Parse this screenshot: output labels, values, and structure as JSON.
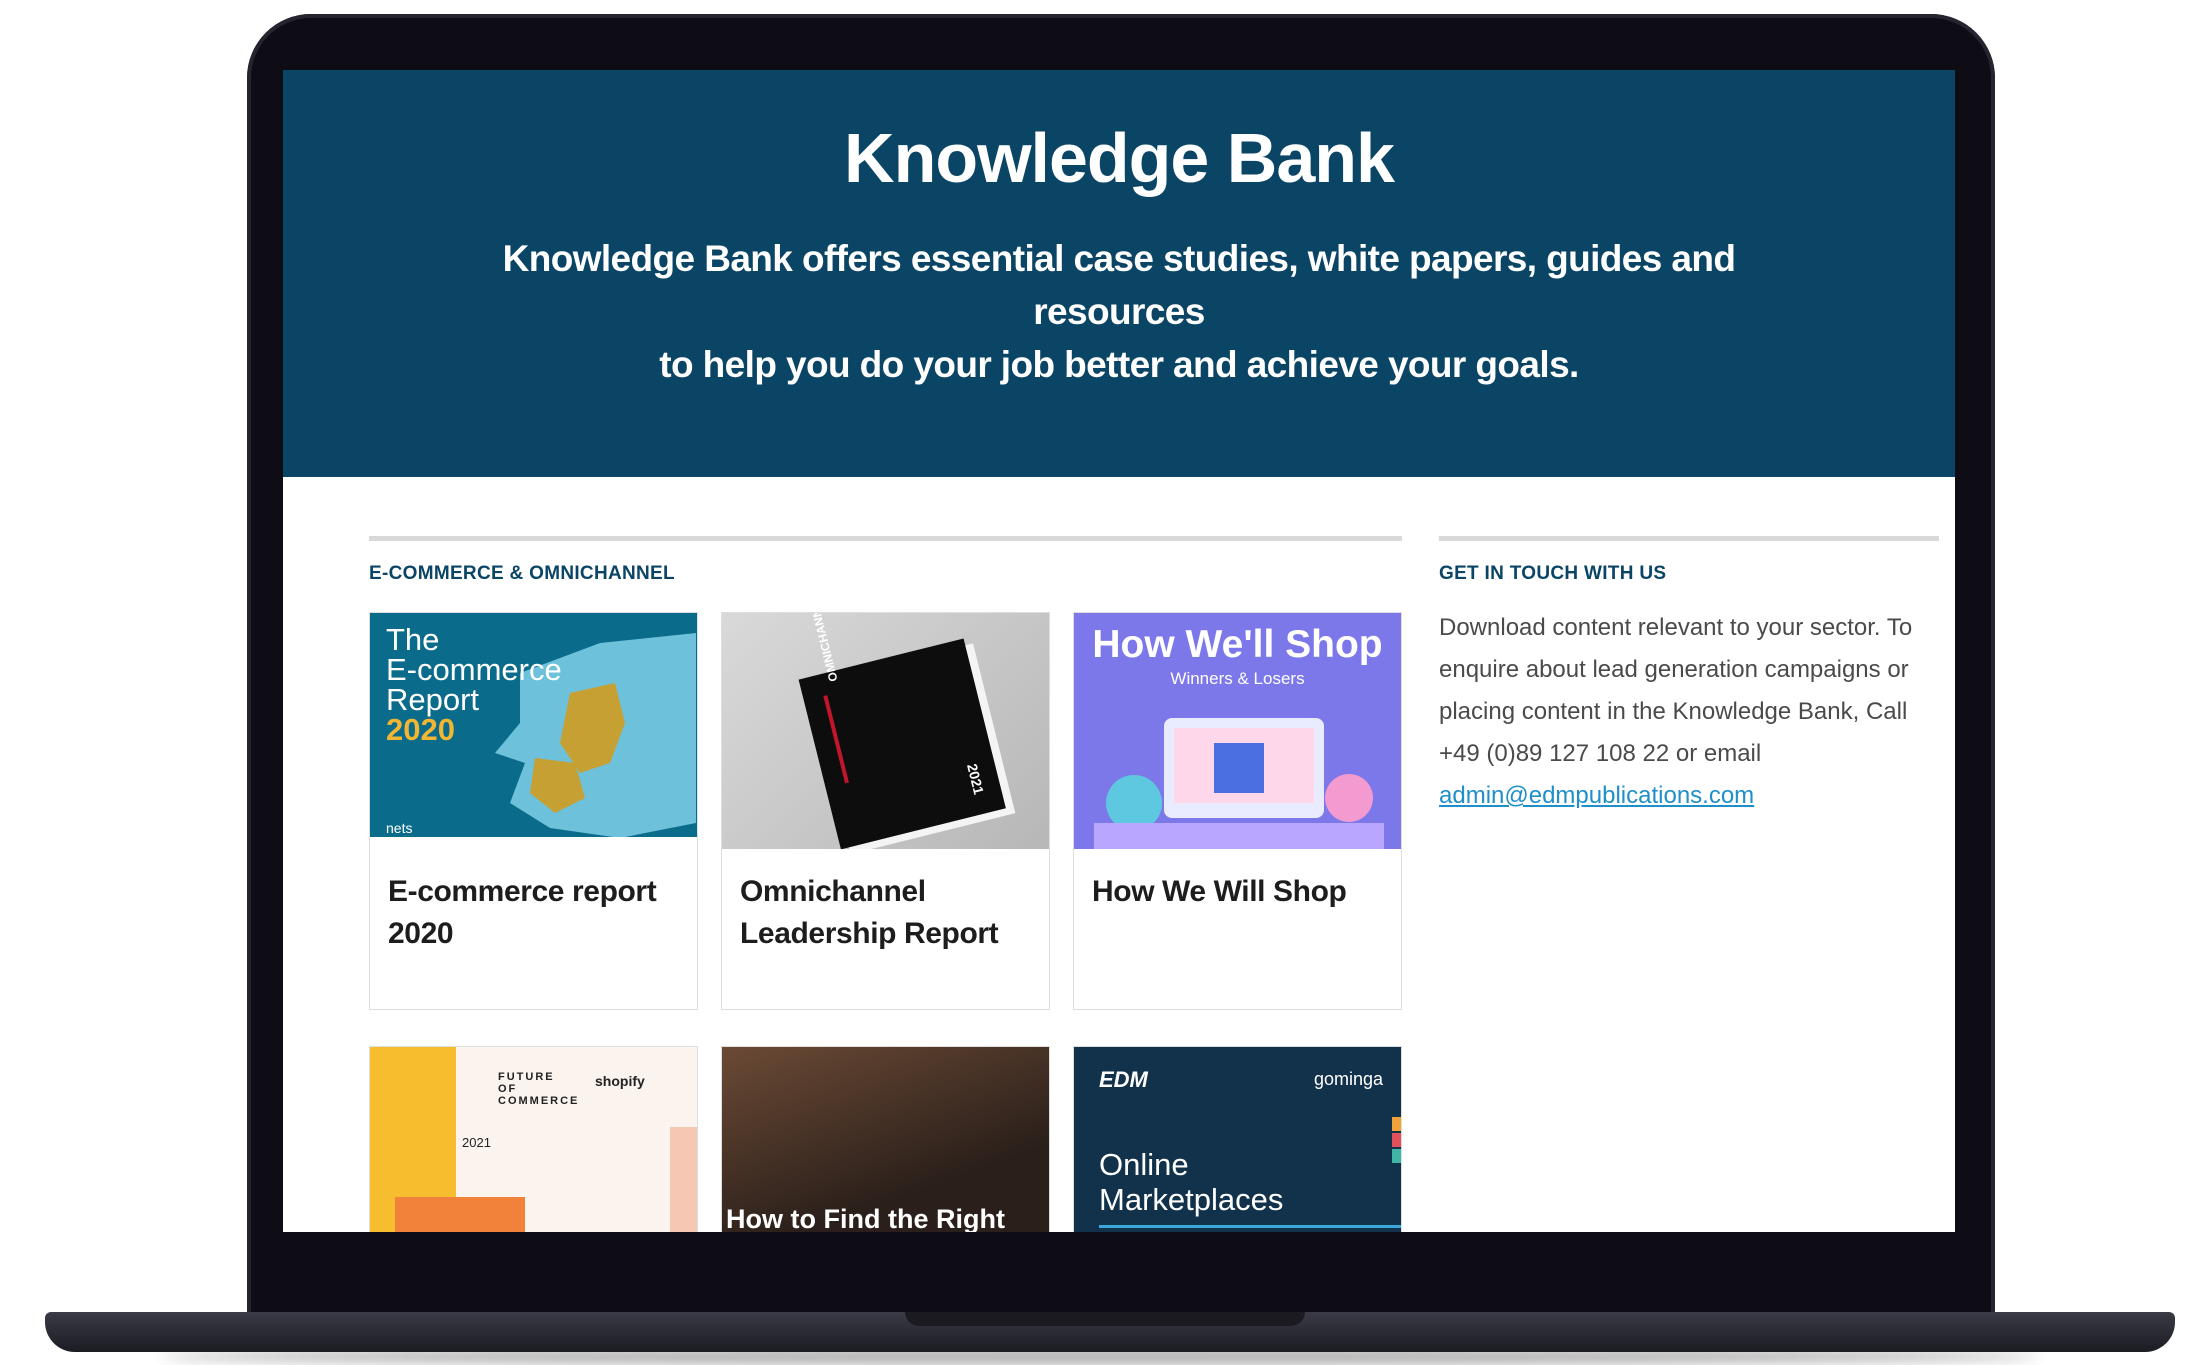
{
  "hero": {
    "title": "Knowledge Bank",
    "subtitle_line1": "Knowledge Bank offers essential case studies, white papers, guides and resources",
    "subtitle_line2": "to help you do your job better and achieve your goals."
  },
  "main": {
    "section_title": "E-COMMERCE & OMNICHANNEL",
    "cards": [
      {
        "title": "E-commerce report 2020",
        "thumb_line1": "The",
        "thumb_line2": "E-commerce",
        "thumb_line3": "Report",
        "thumb_year": "2020",
        "thumb_brand": "nets"
      },
      {
        "title": "Omnichannel Leadership Report",
        "thumb_book_title": "OMNICHANNEL LEADERSHIP REPORT",
        "thumb_book_year": "2021"
      },
      {
        "title": "How We Will Shop",
        "thumb_heading": "How We'll Shop",
        "thumb_sub": "Winners & Losers"
      },
      {
        "title": "",
        "thumb_brand": "FUTURE OF COMMERCE",
        "thumb_brand2": "shopify",
        "thumb_year": "2021"
      },
      {
        "title": "",
        "thumb_caption": "How to Find the Right"
      },
      {
        "title": "",
        "thumb_logo_left": "EDM",
        "thumb_logo_right": "gominga",
        "thumb_caption_line1": "Online",
        "thumb_caption_line2": "Marketplaces"
      }
    ]
  },
  "sidebar": {
    "title": "GET IN TOUCH WITH US",
    "text": "Download content relevant to your sector. To enquire about lead generation campaigns or placing content in the Knowledge Bank, Call +49 (0)89 127 108 22 or email",
    "email": "admin@edmpublications.com"
  },
  "colors": {
    "hero_bg": "#0b4566",
    "accent": "#0b4566",
    "link": "#1f8fc9"
  }
}
